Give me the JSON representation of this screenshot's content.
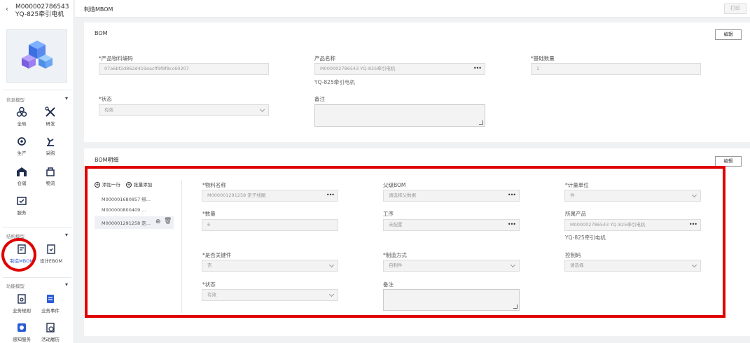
{
  "sidebar": {
    "back_icon": "chevron-left-icon",
    "title_line1": "M000002786543",
    "title_line2": "YQ-825牵引电机",
    "sections": {
      "info": "信息模型",
      "structure": "结构模型",
      "function": "功能模型"
    },
    "items": [
      {
        "label": "全局",
        "icon": "global-icon"
      },
      {
        "label": "研发",
        "icon": "research-icon"
      },
      {
        "label": "生产",
        "icon": "production-icon"
      },
      {
        "label": "采购",
        "icon": "purchase-icon"
      },
      {
        "label": "仓储",
        "icon": "warehouse-icon"
      },
      {
        "label": "物流",
        "icon": "logistics-icon"
      },
      {
        "label": "服务",
        "icon": "service-icon"
      },
      {
        "label": "制造MBOM",
        "icon": "mbom-icon"
      },
      {
        "label": "设计EBOM",
        "icon": "ebom-icon"
      },
      {
        "label": "业务规则",
        "icon": "rule-icon"
      },
      {
        "label": "业务事件",
        "icon": "event-icon"
      },
      {
        "label": "感知服务",
        "icon": "sense-icon"
      },
      {
        "label": "活动履历",
        "icon": "history-icon"
      }
    ]
  },
  "header": {
    "title": "制造MBOM",
    "print_label": "打印"
  },
  "bom": {
    "title": "BOM",
    "edit_label": "编辑",
    "material_code_label": "*产品物料编码",
    "material_code_value": "07a6bf2d862d419eacff9f8f8cc60207",
    "product_name_label": "产品名称",
    "product_name_value": "M000002786543 YQ-825牵引电机",
    "product_name_sub": "YQ-825牵引电机",
    "base_qty_label": "*基础数量",
    "base_qty_value": "1",
    "status_label": "*状态",
    "status_value": "有效",
    "remark_label": "备注"
  },
  "detail": {
    "title": "BOM明细",
    "edit_label": "编辑",
    "add_row_label": "添加一行",
    "batch_add_label": "批量添加",
    "list": [
      "M000001680857 绑...",
      "M000000800409 ...",
      "M000001291258 定..."
    ],
    "material_name_label": "*物料名称",
    "material_name_value": "M000001291258 定子线圈",
    "parent_bom_label": "父级BOM",
    "parent_bom_placeholder": "请选择父数据",
    "unit_label": "*计量单位",
    "unit_value": "件",
    "quantity_label": "*数量",
    "quantity_value": "6",
    "process_label": "工序",
    "process_value": "未配置",
    "product_label": "所属产品",
    "product_value": "M000002786543 YQ-825牵引电机",
    "product_sub": "YQ-825牵引电机",
    "key_part_label": "*是否关键件",
    "key_part_value": "否",
    "mfg_method_label": "*制造方式",
    "mfg_method_value": "自制件",
    "control_code_label": "控制码",
    "control_code_placeholder": "请选择",
    "status_label": "*状态",
    "status_value": "有效",
    "remark_label": "备注"
  }
}
